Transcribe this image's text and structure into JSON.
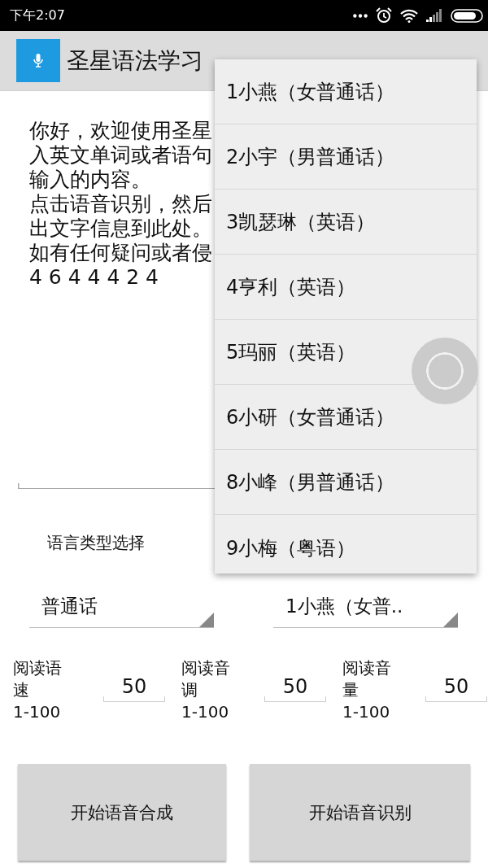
{
  "status_bar": {
    "time": "下午2:07"
  },
  "action_bar": {
    "title": "圣星语法学习"
  },
  "text_area": {
    "lines": [
      "你好，欢迎使用圣星",
      "入英文单词或者语句",
      "输入的内容。",
      "点击语音识别，然后",
      "出文字信息到此处。",
      "如有任何疑问或者侵",
      "4 6 4 4 4 2 4"
    ]
  },
  "language_label": "语言类型选择",
  "spinners": [
    {
      "value": "普通话"
    },
    {
      "value": "1小燕（女普.."
    }
  ],
  "params": [
    {
      "label": "阅读语速",
      "range": "1-100",
      "value": "50"
    },
    {
      "label": "阅读音调",
      "range": "1-100",
      "value": "50"
    },
    {
      "label": "阅读音量",
      "range": "1-100",
      "value": "50"
    }
  ],
  "buttons": [
    "开始语音合成",
    "开始语音识别"
  ],
  "dropdown": {
    "items": [
      "1小燕（女普通话）",
      "2小宇（男普通话）",
      "3凯瑟琳（英语）",
      "4亨利（英语）",
      "5玛丽（英语）",
      "6小研（女普通话）",
      "8小峰（男普通话）",
      "9小梅（粤语）"
    ]
  }
}
